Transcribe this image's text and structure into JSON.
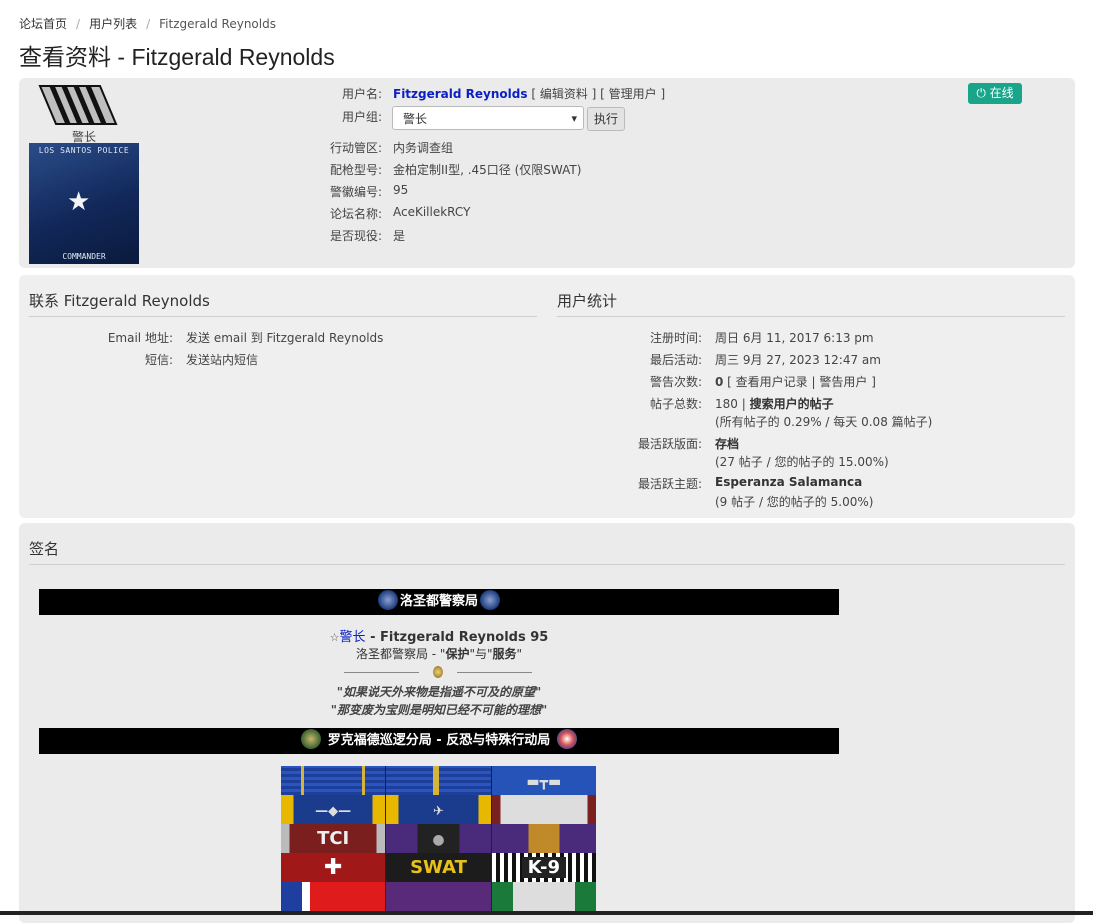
{
  "breadcrumb": {
    "items": [
      "论坛首页",
      "用户列表",
      "Fitzgerald Reynolds"
    ],
    "separator": "/"
  },
  "page_title": "查看资料 - Fitzgerald Reynolds",
  "profile": {
    "rank_label": "警长",
    "avatar": {
      "top_text": "LOS SANTOS POLICE",
      "bottom_text": "COMMANDER"
    },
    "username_label": "用户名:",
    "username": "Fitzgerald Reynolds",
    "edit_link": "编辑资料",
    "manage_link": "管理用户",
    "group_label": "用户组:",
    "group_selected": "警长",
    "exec_button": "执行",
    "online_badge": "在线",
    "fields": [
      {
        "label": "行动管区:",
        "value": "内务调查组"
      },
      {
        "label": "配枪型号:",
        "value": "金柏定制II型, .45口径 (仅限SWAT)"
      },
      {
        "label": "警徽编号:",
        "value": "95"
      },
      {
        "label": "论坛名称:",
        "value": "AceKillekRCY"
      },
      {
        "label": "是否现役:",
        "value": "是"
      }
    ]
  },
  "contact": {
    "heading": "联系 Fitzgerald Reynolds",
    "email_label": "Email 地址:",
    "email_value": "发送 email 到 Fitzgerald Reynolds",
    "pm_label": "短信:",
    "pm_value": "发送站内短信"
  },
  "stats": {
    "heading": "用户统计",
    "joined_label": "注册时间:",
    "joined_value": "周日 6月 11, 2017 6:13 pm",
    "last_active_label": "最后活动:",
    "last_active_value": "周三 9月 27, 2023 12:47 am",
    "warnings_label": "警告次数:",
    "warnings_count": "0",
    "view_record_link": "查看用户记录",
    "warn_user_link": "警告用户",
    "posts_label": "帖子总数:",
    "posts_count": "180",
    "search_posts_link": "搜索用户的帖子",
    "posts_detail": "(所有帖子的 0.29% / 每天 0.08 篇帖子)",
    "active_forum_label": "最活跃版面:",
    "active_forum": "存档",
    "active_forum_detail": "(27 帖子 / 您的帖子的 15.00%)",
    "active_topic_label": "最活跃主题:",
    "active_topic": "Esperanza Salamanca",
    "active_topic_detail": "(9 帖子 / 您的帖子的 5.00%)"
  },
  "signature": {
    "heading": "签名",
    "bar1": "洛圣都警察局",
    "rank": "警长",
    "name_line": " - Fitzgerald Reynolds 95",
    "motto_prefix": "洛圣都警察局 - \"",
    "motto_protect": "保护",
    "motto_and": "\"与\"",
    "motto_serve": "服务",
    "motto_suffix": "\"",
    "quote1": "\"如果说天外来物是指遥不可及的原望\"",
    "quote2": "\"那变废为宝则是明知已经不可能的理想\"",
    "bar2": "罗克福德巡逻分局 - 反恐与特殊行动局",
    "ribbon_tci": "TCI",
    "ribbon_swat": "SWAT",
    "ribbon_k9": "K-9"
  },
  "colors": {
    "online": "#18a589",
    "username": "#0a1fc4",
    "panel": "#ebebeb"
  }
}
